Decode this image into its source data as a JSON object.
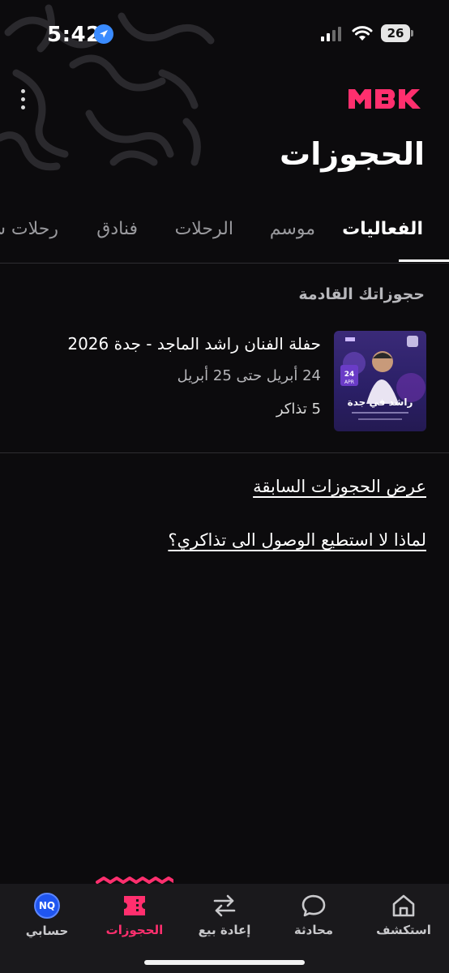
{
  "status_bar": {
    "time": "5:42",
    "battery": "26",
    "icons": [
      "location-arrow-icon",
      "cellular-signal-icon",
      "wifi-icon",
      "battery-icon"
    ]
  },
  "header": {
    "logo_text": "MBK",
    "title": "الحجوزات",
    "menu_icon": "vertical-dots-icon"
  },
  "tabs": [
    {
      "label": "الفعاليات",
      "active": true
    },
    {
      "label": "موسم",
      "active": false
    },
    {
      "label": "الرحلات",
      "active": false
    },
    {
      "label": "فنادق",
      "active": false
    },
    {
      "label": "رحلات س",
      "active": false
    }
  ],
  "upcoming": {
    "heading": "حجوزاتك القادمة",
    "bookings": [
      {
        "title": "حفلة الفنان راشد الماجد - جدة 2026",
        "dates": "24 أبريل حتى 25 أبريل",
        "tickets": "5 تذاكر",
        "thumb_text": "راشد في جدة",
        "thumb_date_day": "24",
        "thumb_date_month": "APR"
      }
    ]
  },
  "links": {
    "past_bookings": "عرض الحجوزات السابقة",
    "why_cant_access": "لماذا لا استطيع الوصول الى تذاكري؟"
  },
  "bottom_nav": {
    "items": [
      {
        "label": "حسابي",
        "icon": "avatar-icon",
        "avatar_text": "NQ"
      },
      {
        "label": "الحجوزات",
        "icon": "ticket-icon",
        "active": true
      },
      {
        "label": "إعادة بيع",
        "icon": "swap-arrows-icon"
      },
      {
        "label": "محادثة",
        "icon": "chat-bubble-icon"
      },
      {
        "label": "استكشف",
        "icon": "home-icon"
      }
    ]
  },
  "colors": {
    "background": "#0c0b0d",
    "accent": "#ff2f6e",
    "nav_background": "#1a191c",
    "avatar": "#1f55f0"
  }
}
